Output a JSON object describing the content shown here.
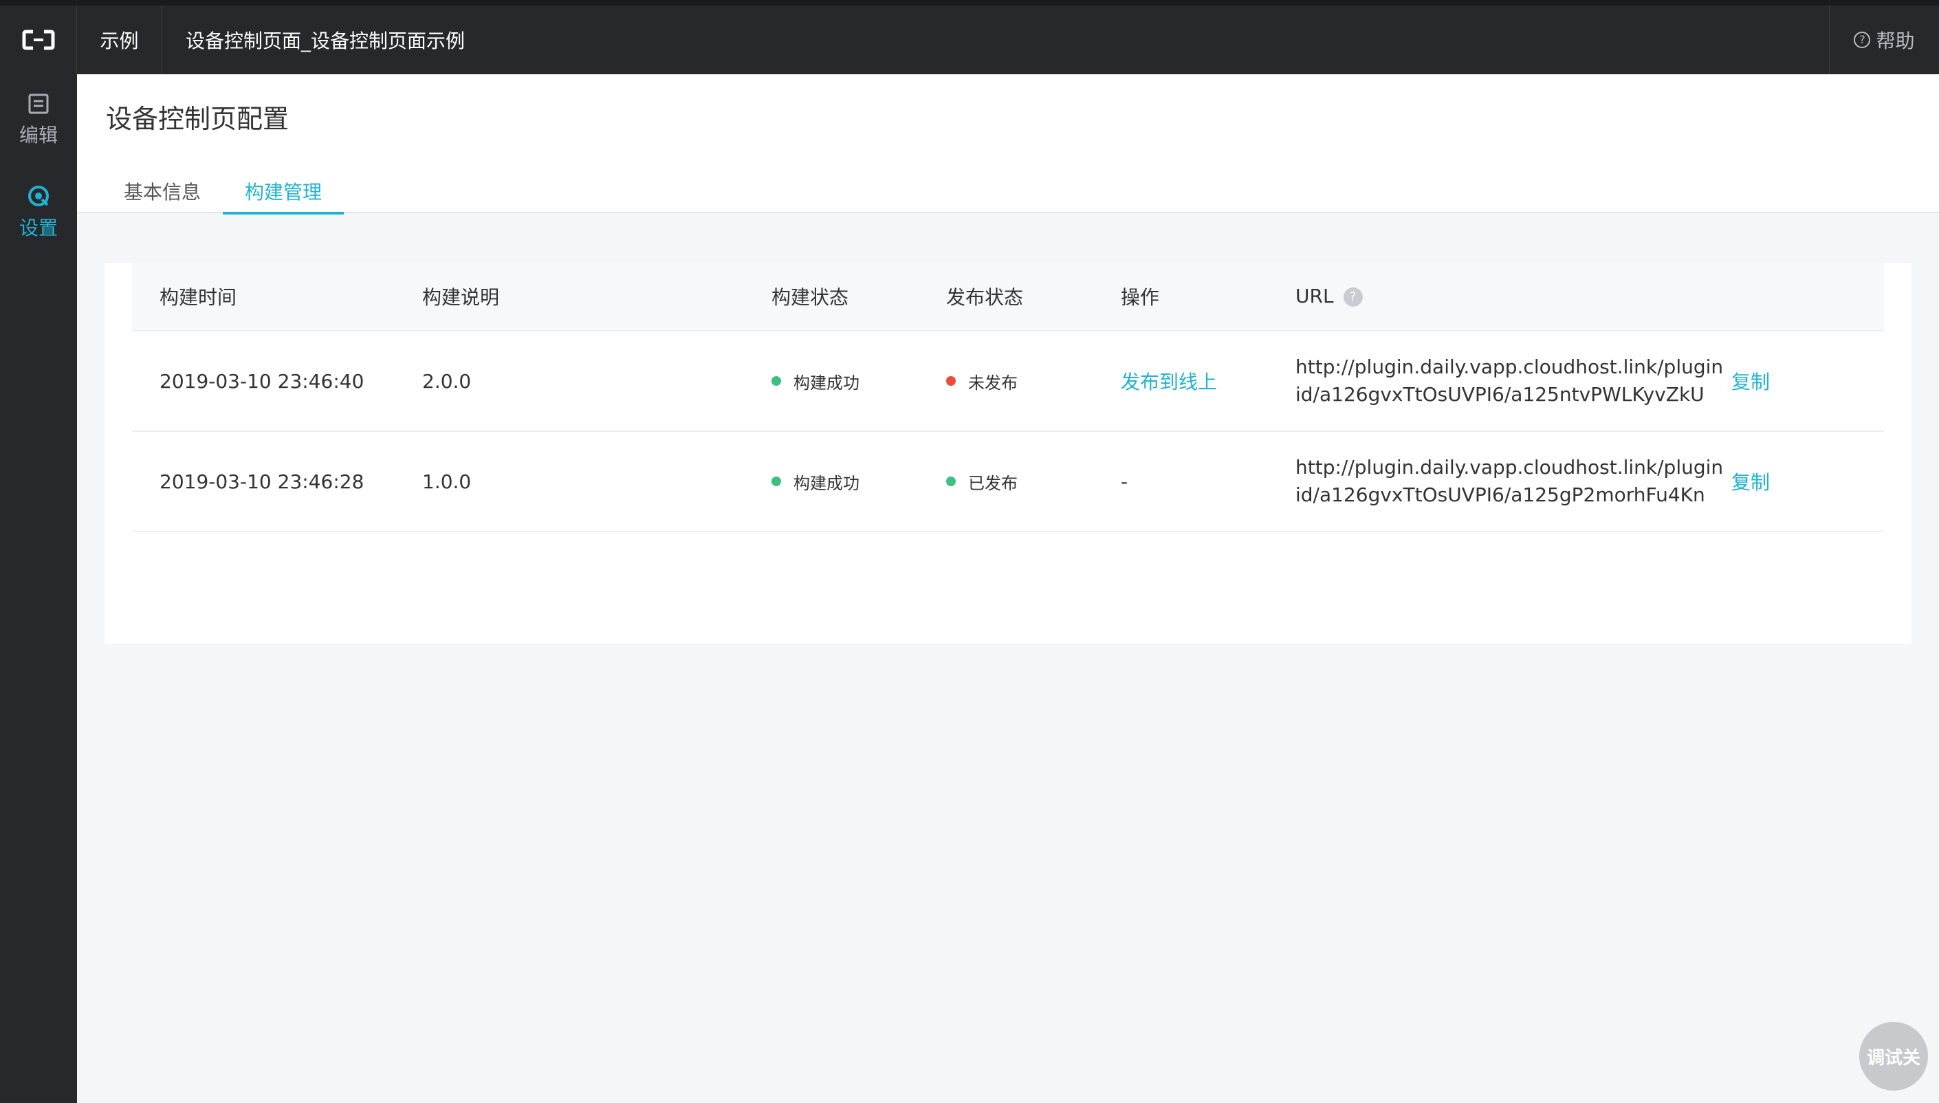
{
  "topbar": {
    "root_crumb": "示例",
    "title": "设备控制页面_设备控制页面示例",
    "help_label": "帮助"
  },
  "sidebar": {
    "items": [
      {
        "label": "编辑",
        "icon": "edit-icon"
      },
      {
        "label": "设置",
        "icon": "settings-icon",
        "active": true
      }
    ]
  },
  "page": {
    "title": "设备控制页配置",
    "tabs": [
      {
        "label": "基本信息",
        "active": false
      },
      {
        "label": "构建管理",
        "active": true
      }
    ]
  },
  "table": {
    "headers": [
      "构建时间",
      "构建说明",
      "构建状态",
      "发布状态",
      "操作",
      "URL"
    ],
    "rows": [
      {
        "time": "2019-03-10 23:46:40",
        "desc": "2.0.0",
        "build_status": "构建成功",
        "publish_status": "未发布",
        "action": "发布到线上",
        "url_line1": "http://plugin.daily.vapp.cloudhost.link/plugin",
        "url_line2": "id/a126gvxTtOsUVPI6/a125ntvPWLKyvZkU",
        "copy": "复制"
      },
      {
        "time": "2019-03-10 23:46:28",
        "desc": "1.0.0",
        "build_status": "构建成功",
        "publish_status": "已发布",
        "action": "-",
        "url_line1": "http://plugin.daily.vapp.cloudhost.link/plugin",
        "url_line2": "id/a126gvxTtOsUVPI6/a125gP2morhFu4Kn",
        "copy": "复制"
      }
    ]
  },
  "colors": {
    "accent": "#1fb3d1",
    "success": "#3dbf7f",
    "error": "#f04a3a",
    "topbar": "#26282c"
  },
  "debug_button": "调试关"
}
